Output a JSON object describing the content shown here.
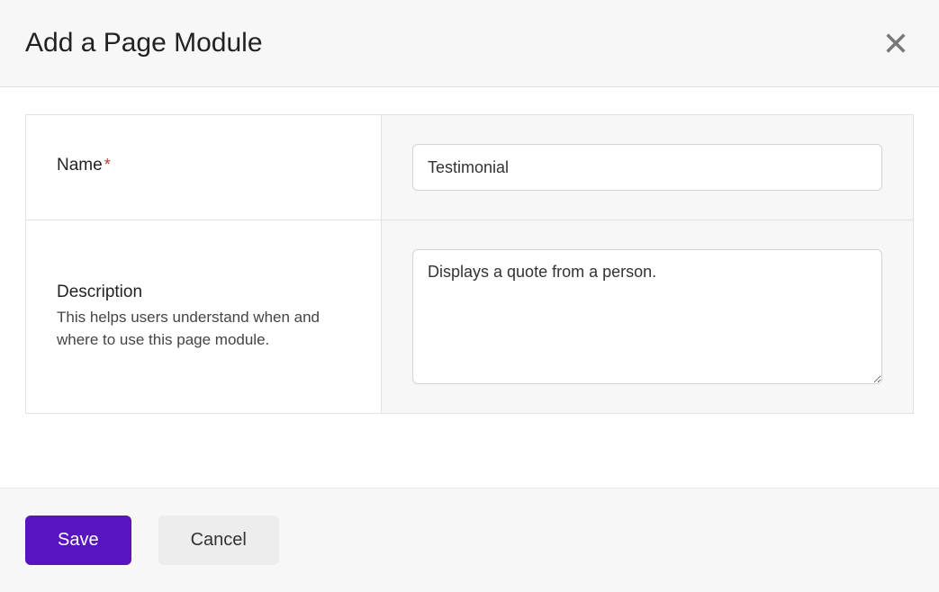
{
  "header": {
    "title": "Add a Page Module",
    "close_icon": "close-icon"
  },
  "form": {
    "name": {
      "label": "Name",
      "required_mark": "*",
      "value": "Testimonial"
    },
    "description": {
      "label": "Description",
      "helper": "This helps users understand when and where to use this page module.",
      "value": "Displays a quote from a person."
    }
  },
  "footer": {
    "save_label": "Save",
    "cancel_label": "Cancel"
  },
  "colors": {
    "primary": "#5714c0",
    "surface": "#f7f7f7",
    "border": "#e2e2e2"
  }
}
